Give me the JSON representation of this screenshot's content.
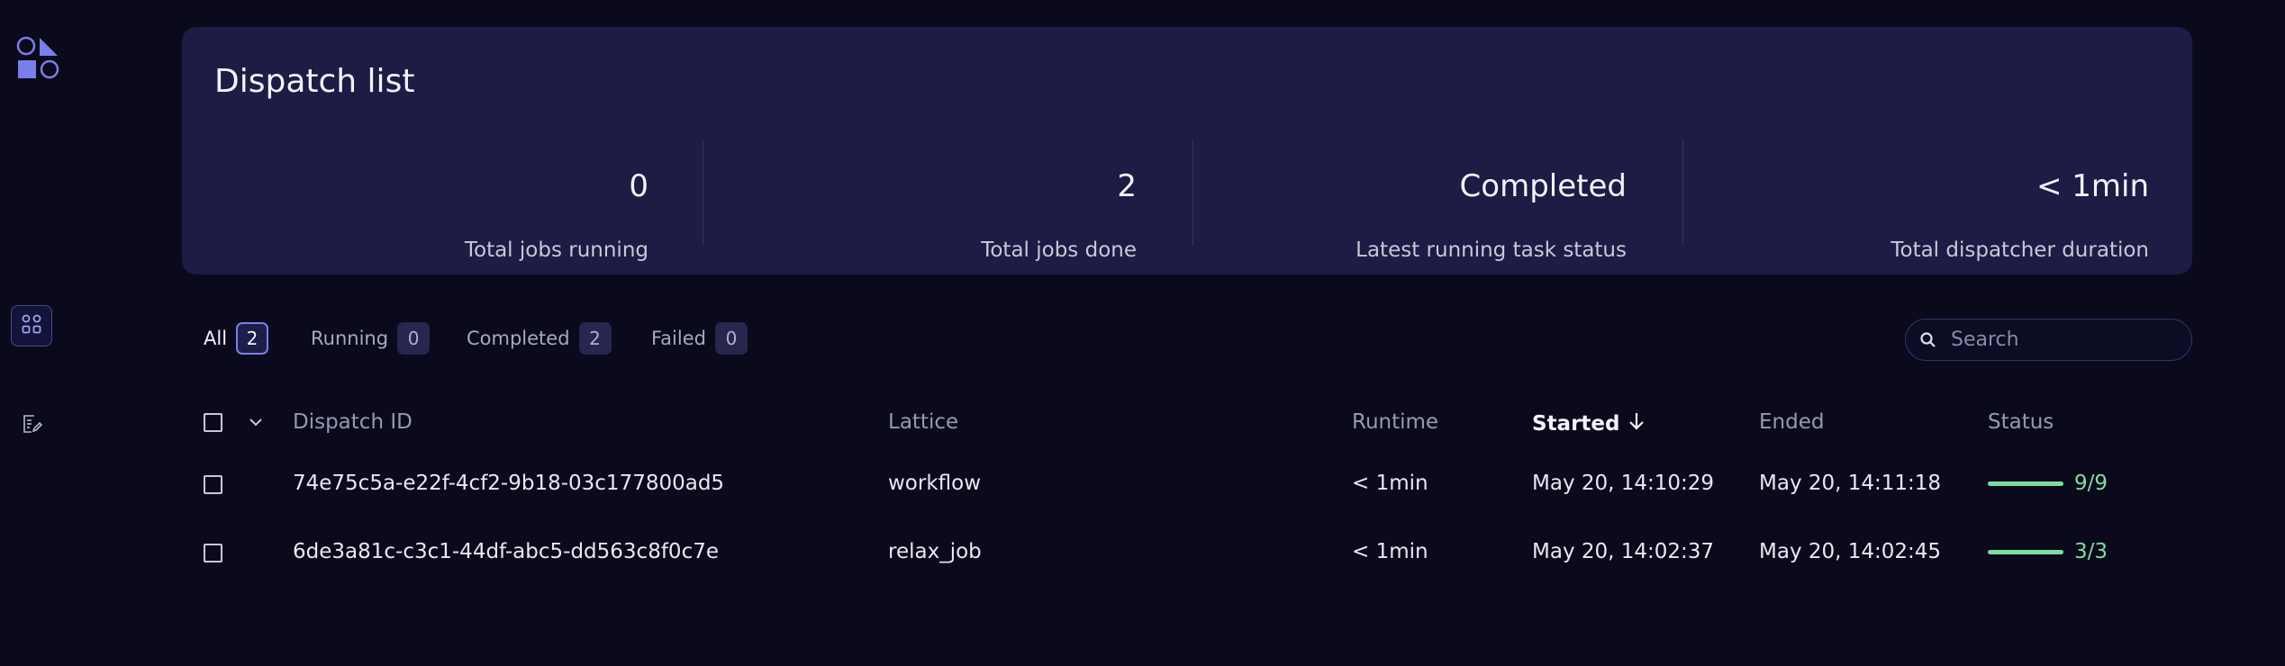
{
  "summary": {
    "title": "Dispatch list",
    "stats": [
      {
        "value": "0",
        "label": "Total jobs running"
      },
      {
        "value": "2",
        "label": "Total jobs done"
      },
      {
        "value": "Completed",
        "label": "Latest running task status"
      },
      {
        "value": "< 1min",
        "label": "Total dispatcher duration"
      }
    ]
  },
  "filters": [
    {
      "label": "All",
      "count": "2"
    },
    {
      "label": "Running",
      "count": "0"
    },
    {
      "label": "Completed",
      "count": "2"
    },
    {
      "label": "Failed",
      "count": "0"
    }
  ],
  "search": {
    "placeholder": "Search"
  },
  "table": {
    "headers": {
      "dispatch_id": "Dispatch ID",
      "lattice": "Lattice",
      "runtime": "Runtime",
      "started": "Started",
      "ended": "Ended",
      "status": "Status"
    },
    "rows": [
      {
        "dispatch_id": "74e75c5a-e22f-4cf2-9b18-03c177800ad5",
        "lattice": "workflow",
        "runtime": "< 1min",
        "started": "May 20, 14:10:29",
        "ended": "May 20, 14:11:18",
        "status": "9/9",
        "progress": 1.0
      },
      {
        "dispatch_id": "6de3a81c-c3c1-44df-abc5-dd563c8f0c7e",
        "lattice": "relax_job",
        "runtime": "< 1min",
        "started": "May 20, 14:02:37",
        "ended": "May 20, 14:02:45",
        "status": "3/3",
        "progress": 1.0
      }
    ]
  },
  "colors": {
    "background": "#0a0a1c",
    "panel": "#1c1c44",
    "accent": "#7a7ee8",
    "success": "#7fdc9f"
  },
  "icons": {
    "logo": "shapes-logo-icon",
    "nav_dispatches": "grid-nodes-icon",
    "nav_logs": "document-edit-icon",
    "search": "search-icon",
    "sort": "arrow-down-icon",
    "select_menu": "chevron-down-icon"
  }
}
